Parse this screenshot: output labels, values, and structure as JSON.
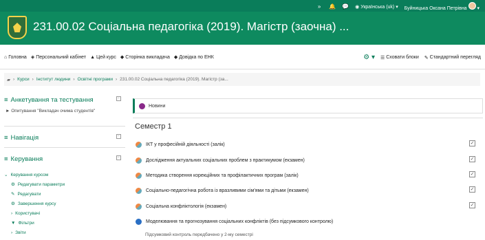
{
  "topbar": {
    "language": "Українська (uk)",
    "user_name": "Буйницька Оксана Петрівна"
  },
  "header": {
    "title": "231.00.02 Соціальна педагогіка (2019). Магістр (заочна) ..."
  },
  "navbar": {
    "items": [
      "Головна",
      "Персональний кабінет",
      "Цей курс",
      "Сторінка викладача",
      "Довідка по ЕНК"
    ],
    "hide_blocks": "Сховати блоки",
    "standard_view": "Стандартний перегляд"
  },
  "breadcrumb": {
    "items": [
      "Курси",
      "Інститут людини",
      "Освітні програми",
      "231.00.02 Соціальна педагогіка (2019). Магістр (за..."
    ]
  },
  "sidebar": {
    "survey": {
      "title": "Анкетування та тестування",
      "item": "Опитування \"Викладач очима студентів\""
    },
    "navigation": {
      "title": "Навігація"
    },
    "admin": {
      "title": "Керування",
      "items": [
        "Керування курсом",
        "Редагувати параметри",
        "Редагувати",
        "Завершення курсу",
        "Користувачі",
        "Фільтри",
        "Звіти"
      ]
    }
  },
  "main": {
    "news": "Новини",
    "semester": "Семестр 1",
    "activities": [
      "ІКТ у професійній діяльності (залік)",
      "Дослідження актуальних соціальних проблем з практикумом (екзамен)",
      "Методика створення корекційних та профілактичних програм (залік)",
      "Соціально-педагогічна робота із вразливими сім'ями та дітьми (екзамен)",
      "Соціальна конфліктологія (екзамен)",
      "Моделювання та прогнозування соціальних конфліктів (без підсумкового контролю)"
    ],
    "note": "Підсумковий контроль передбачено у 2-му семестрі"
  }
}
